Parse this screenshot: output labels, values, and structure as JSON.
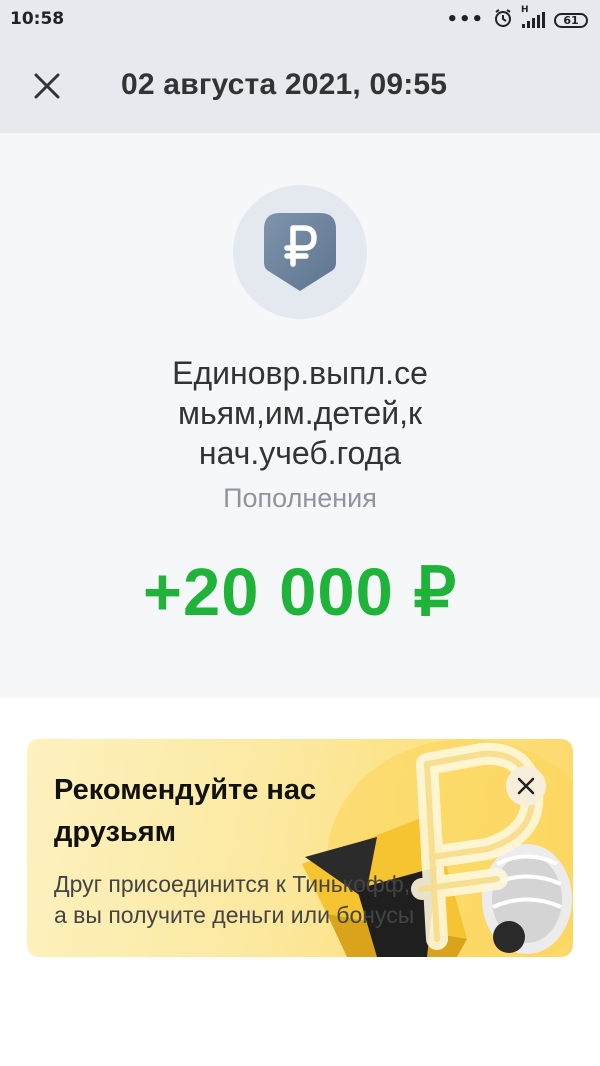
{
  "status_bar": {
    "time": "10:58",
    "dots": "•••",
    "network": "H",
    "battery": "61"
  },
  "header": {
    "title": "02 августа 2021, 09:55",
    "close_icon": "close-icon"
  },
  "operation": {
    "icon": "ruble-icon",
    "title_lines": [
      "Единовр.выпл.се",
      "мьям,им.детей,к",
      "нач.учеб.года"
    ],
    "category": "Пополнения",
    "amount": "+20 000 ₽",
    "amount_color": "#1fb33a"
  },
  "promo": {
    "title_line1": "Рекомендуйте нас",
    "title_line2": "друзьям",
    "text_line1": "Друг присоединится к Тинькофф,",
    "text_line2": "а вы получите деньги или бонусы",
    "close_icon": "close-icon"
  }
}
